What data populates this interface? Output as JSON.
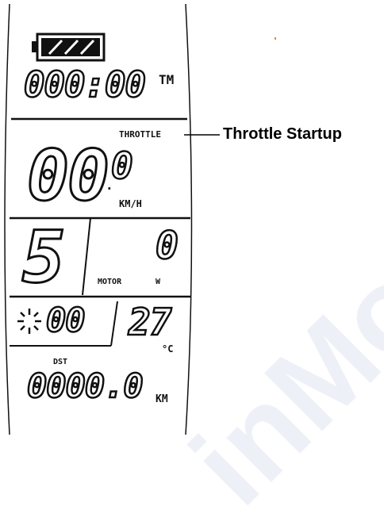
{
  "display": {
    "time": "000:00",
    "time_unit": "TM",
    "throttle_label": "THROTTLE",
    "speed": "00",
    "speed_decimal": "0",
    "speed_unit": "KM/H",
    "assist_level": "5",
    "power": "0",
    "motor_label": "MOTOR",
    "power_unit": "W",
    "light_value": "00",
    "temperature": "27",
    "temperature_unit": "°C",
    "distance_label": "DST",
    "distance": "0000.0",
    "distance_unit": "KM"
  },
  "callout": {
    "label": "Throttle Startup"
  },
  "icons": {
    "battery": "battery-icon",
    "light": "light-sun-icon"
  },
  "watermark": {
    "text": "inMo"
  }
}
